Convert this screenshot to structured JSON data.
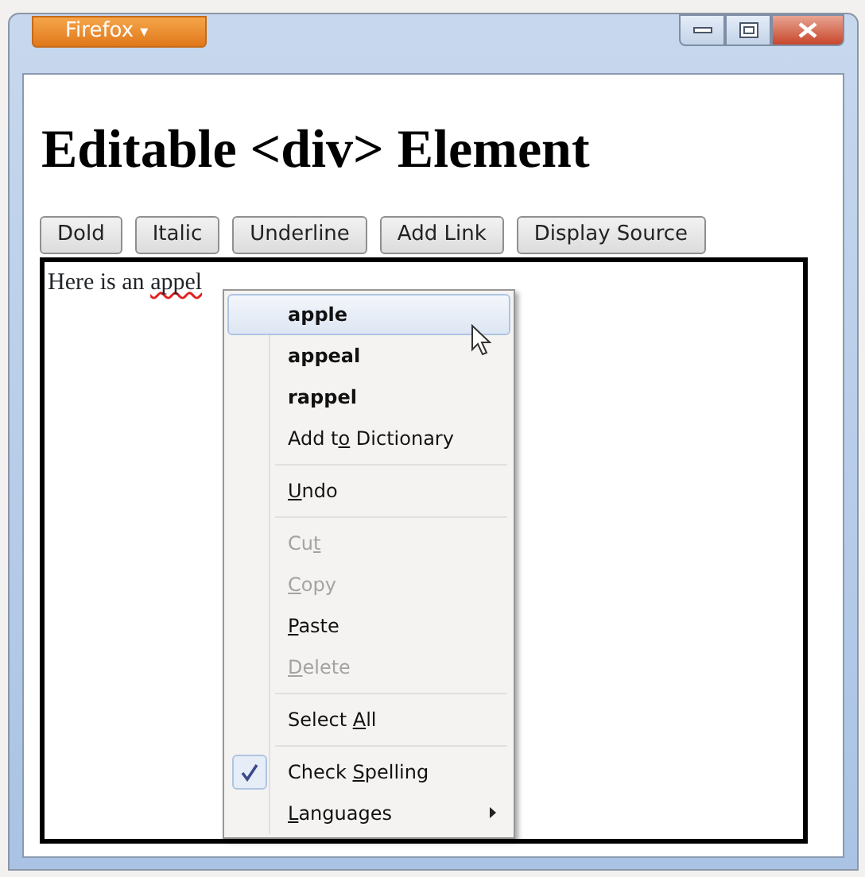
{
  "window": {
    "app_button": "Firefox",
    "app_button_caret": "▾"
  },
  "page": {
    "heading": "Editable <div> Element"
  },
  "toolbar": [
    "Dold",
    "Italic",
    "Underline",
    "Add Link",
    "Display Source"
  ],
  "editor": {
    "text": "Here is an ",
    "misspelled_word": "appel"
  },
  "context_menu": {
    "items": [
      {
        "kind": "suggestion",
        "label_parts": [
          {
            "text": "apple",
            "underlined": false
          }
        ],
        "selected": true,
        "disabled": false
      },
      {
        "kind": "suggestion",
        "label_parts": [
          {
            "text": "appeal",
            "underlined": false
          }
        ],
        "selected": false,
        "disabled": false
      },
      {
        "kind": "suggestion",
        "label_parts": [
          {
            "text": "rappel",
            "underlined": false
          }
        ],
        "selected": false,
        "disabled": false
      },
      {
        "kind": "command",
        "label_parts": [
          {
            "text": "Add t",
            "underlined": false
          },
          {
            "text": "o",
            "underlined": true
          },
          {
            "text": " Dictionary",
            "underlined": false
          }
        ],
        "selected": false,
        "disabled": false
      },
      {
        "kind": "separator"
      },
      {
        "kind": "command",
        "label_parts": [
          {
            "text": "U",
            "underlined": true
          },
          {
            "text": "ndo",
            "underlined": false
          }
        ],
        "selected": false,
        "disabled": false
      },
      {
        "kind": "separator"
      },
      {
        "kind": "command",
        "label_parts": [
          {
            "text": "Cu",
            "underlined": false
          },
          {
            "text": "t",
            "underlined": true
          }
        ],
        "selected": false,
        "disabled": true
      },
      {
        "kind": "command",
        "label_parts": [
          {
            "text": "C",
            "underlined": true
          },
          {
            "text": "opy",
            "underlined": false
          }
        ],
        "selected": false,
        "disabled": true
      },
      {
        "kind": "command",
        "label_parts": [
          {
            "text": "P",
            "underlined": true
          },
          {
            "text": "aste",
            "underlined": false
          }
        ],
        "selected": false,
        "disabled": false
      },
      {
        "kind": "command",
        "label_parts": [
          {
            "text": "D",
            "underlined": true
          },
          {
            "text": "elete",
            "underlined": false
          }
        ],
        "selected": false,
        "disabled": true
      },
      {
        "kind": "separator"
      },
      {
        "kind": "command",
        "label_parts": [
          {
            "text": "Select ",
            "underlined": false
          },
          {
            "text": "A",
            "underlined": true
          },
          {
            "text": "ll",
            "underlined": false
          }
        ],
        "selected": false,
        "disabled": false
      },
      {
        "kind": "separator"
      },
      {
        "kind": "check",
        "label_parts": [
          {
            "text": "Check ",
            "underlined": false
          },
          {
            "text": "S",
            "underlined": true
          },
          {
            "text": "pelling",
            "underlined": false
          }
        ],
        "checked": true,
        "selected": false,
        "disabled": false
      },
      {
        "kind": "submenu",
        "label_parts": [
          {
            "text": "L",
            "underlined": true
          },
          {
            "text": "anguages",
            "underlined": false
          }
        ],
        "selected": false,
        "disabled": false
      }
    ]
  }
}
